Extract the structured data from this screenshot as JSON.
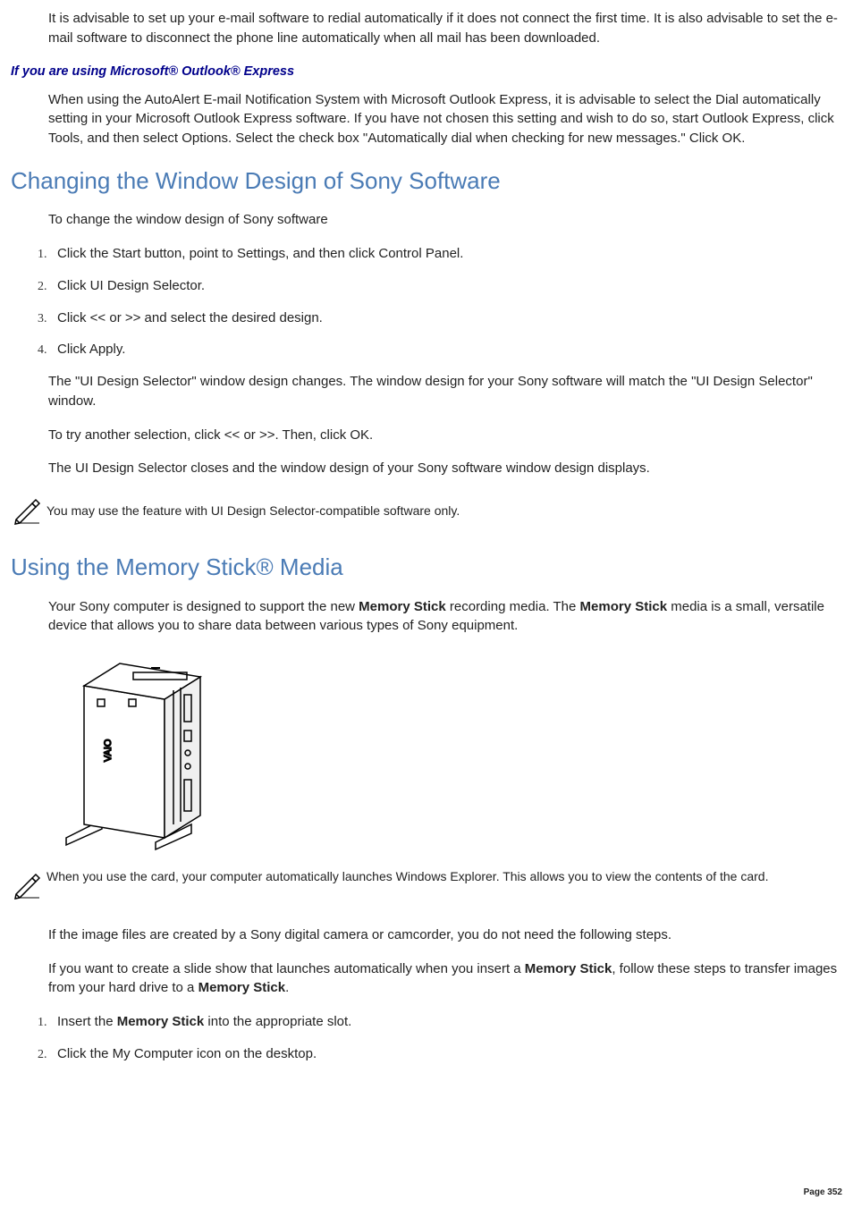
{
  "intro_paragraph": "It is advisable to set up your e-mail software to redial automatically if it does not connect the first time. It is also advisable to set the e-mail software to disconnect the phone line automatically when all mail has been downloaded.",
  "outlook_heading": "If you are using Microsoft® Outlook® Express",
  "outlook_paragraph": "When using the AutoAlert E-mail Notification System with Microsoft Outlook Express, it is advisable to select the Dial automatically setting in your Microsoft Outlook Express software. If you have not chosen this setting and wish to do so, start Outlook Express, click Tools, and then select Options. Select the check box \"Automatically dial when checking for new messages.\" Click OK.",
  "changing_heading": "Changing the Window Design of Sony Software",
  "changing_intro": "To change the window design of Sony software",
  "changing_steps": [
    "Click the Start button, point to Settings, and then click Control Panel.",
    "Click UI Design Selector.",
    "Click << or >> and select the desired design.",
    "Click Apply."
  ],
  "changing_p1": "The \"UI Design Selector\" window design changes. The window design for your Sony software will match the \"UI Design Selector\" window.",
  "changing_p2": "To try another selection, click << or >>. Then, click OK.",
  "changing_p3": "The UI Design Selector closes and the window design of your Sony software window design displays.",
  "note1": "You may use the feature with UI Design Selector-compatible software only.",
  "memstick_heading": "Using the Memory Stick® Media",
  "memstick_p1_pre": "Your Sony computer is designed to support the new ",
  "memstick_bold1": "Memory Stick",
  "memstick_p1_mid": " recording media. The ",
  "memstick_bold2": "Memory Stick",
  "memstick_p1_post": " media is a small, versatile device that allows you to share data between various types of Sony equipment.",
  "note2": "When you use the card, your computer automatically launches Windows Explorer. This allows you to view the contents of the card.",
  "memstick_p2": "If the image files are created by a Sony digital camera or camcorder, you do not need the following steps.",
  "memstick_p3_pre": "If you want to create a slide show that launches automatically when you insert a ",
  "memstick_bold3": "Memory Stick",
  "memstick_p3_mid": ", follow these steps to transfer images from your hard drive to a ",
  "memstick_bold4": "Memory Stick",
  "memstick_p3_post": ".",
  "memstick_steps": {
    "s1_pre": "Insert the ",
    "s1_bold": "Memory Stick",
    "s1_post": " into the appropriate slot.",
    "s2": "Click the My Computer icon on the desktop."
  },
  "page_number": "Page 352"
}
